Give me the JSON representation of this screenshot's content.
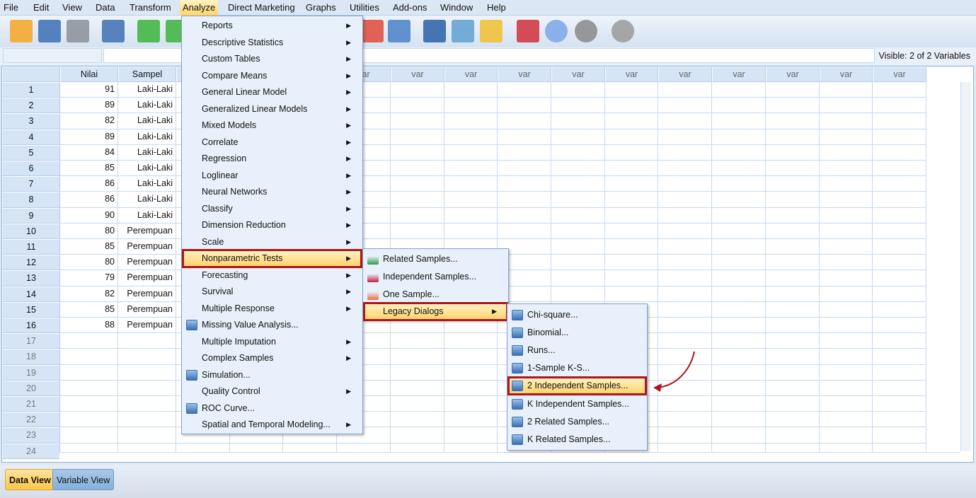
{
  "menubar": [
    "File",
    "Edit",
    "View",
    "Data",
    "Transform",
    "Analyze",
    "Direct Marketing",
    "Graphs",
    "Utilities",
    "Add-ons",
    "Window",
    "Help"
  ],
  "toolbar": {
    "icons": [
      "open-folder-icon",
      "save-icon",
      "print-icon",
      "dialog-recall-icon",
      "undo-icon",
      "redo-icon",
      "select-cases-icon",
      "weight-cases-icon",
      "split-file-icon",
      "balance-scale-icon",
      "value-labels-icon",
      "use-sets-icon",
      "venn-icon",
      "venn-gray-icon",
      "spell-check-icon"
    ]
  },
  "status": {
    "visible": "Visible: 2 of 2 Variables"
  },
  "grid": {
    "columns": [
      "Nilai",
      "Sampel",
      "var",
      "var",
      "var",
      "var",
      "var",
      "var",
      "var",
      "var",
      "var",
      "var",
      "var",
      "var",
      "var",
      "var"
    ],
    "rows": [
      [
        "91",
        "Laki-Laki"
      ],
      [
        "89",
        "Laki-Laki"
      ],
      [
        "82",
        "Laki-Laki"
      ],
      [
        "89",
        "Laki-Laki"
      ],
      [
        "84",
        "Laki-Laki"
      ],
      [
        "85",
        "Laki-Laki"
      ],
      [
        "86",
        "Laki-Laki"
      ],
      [
        "86",
        "Laki-Laki"
      ],
      [
        "90",
        "Laki-Laki"
      ],
      [
        "80",
        "Perempuan"
      ],
      [
        "85",
        "Perempuan"
      ],
      [
        "80",
        "Perempuan"
      ],
      [
        "79",
        "Perempuan"
      ],
      [
        "82",
        "Perempuan"
      ],
      [
        "85",
        "Perempuan"
      ],
      [
        "88",
        "Perempuan"
      ]
    ],
    "row_numbers": [
      "1",
      "2",
      "3",
      "4",
      "5",
      "6",
      "7",
      "8",
      "9",
      "10",
      "11",
      "12",
      "13",
      "14",
      "15",
      "16",
      "17",
      "18",
      "19",
      "20",
      "21",
      "22",
      "23",
      "24"
    ]
  },
  "analyze_menu": [
    {
      "label": "Reports",
      "sub": true
    },
    {
      "label": "Descriptive Statistics",
      "sub": true
    },
    {
      "label": "Custom Tables",
      "sub": true
    },
    {
      "label": "Compare Means",
      "sub": true
    },
    {
      "label": "General Linear Model",
      "sub": true
    },
    {
      "label": "Generalized Linear Models",
      "sub": true
    },
    {
      "label": "Mixed Models",
      "sub": true
    },
    {
      "label": "Correlate",
      "sub": true
    },
    {
      "label": "Regression",
      "sub": true
    },
    {
      "label": "Loglinear",
      "sub": true
    },
    {
      "label": "Neural Networks",
      "sub": true
    },
    {
      "label": "Classify",
      "sub": true
    },
    {
      "label": "Dimension Reduction",
      "sub": true
    },
    {
      "label": "Scale",
      "sub": true
    },
    {
      "label": "Nonparametric Tests",
      "sub": true,
      "highlight": true
    },
    {
      "label": "Forecasting",
      "sub": true
    },
    {
      "label": "Survival",
      "sub": true
    },
    {
      "label": "Multiple Response",
      "sub": true
    },
    {
      "label": "Missing Value Analysis...",
      "icon": "missing-value-icon"
    },
    {
      "label": "Multiple Imputation",
      "sub": true
    },
    {
      "label": "Complex Samples",
      "sub": true
    },
    {
      "label": "Simulation...",
      "icon": "simulation-icon"
    },
    {
      "label": "Quality Control",
      "sub": true
    },
    {
      "label": "ROC Curve...",
      "icon": "roc-curve-icon"
    },
    {
      "label": "Spatial and Temporal Modeling...",
      "sub": true
    }
  ],
  "nonparametric_menu": [
    {
      "label": "Related Samples...",
      "icon": "related-samples-icon",
      "color": "#2e9a4a"
    },
    {
      "label": "Independent Samples...",
      "icon": "independent-samples-icon",
      "color": "#c02040"
    },
    {
      "label": "One Sample...",
      "icon": "one-sample-icon",
      "color": "#e8704a"
    },
    {
      "label": "Legacy Dialogs",
      "sub": true,
      "highlight": true
    }
  ],
  "legacy_menu": [
    {
      "label": "Chi-square...",
      "icon": "chi-square-icon"
    },
    {
      "label": "Binomial...",
      "icon": "binomial-icon"
    },
    {
      "label": "Runs...",
      "icon": "runs-icon"
    },
    {
      "label": "1-Sample K-S...",
      "icon": "ks-icon"
    },
    {
      "label": "2 Independent Samples...",
      "icon": "two-independent-icon",
      "highlight": true
    },
    {
      "label": "K Independent Samples...",
      "icon": "k-independent-icon"
    },
    {
      "label": "2 Related Samples...",
      "icon": "two-related-icon"
    },
    {
      "label": "K Related Samples...",
      "icon": "k-related-icon"
    }
  ],
  "tabs": [
    "Data View",
    "Variable View"
  ],
  "colors": {
    "highlight_border": "#b0151b",
    "arrow": "#b0151b",
    "active_tab": "#ffd36b"
  }
}
